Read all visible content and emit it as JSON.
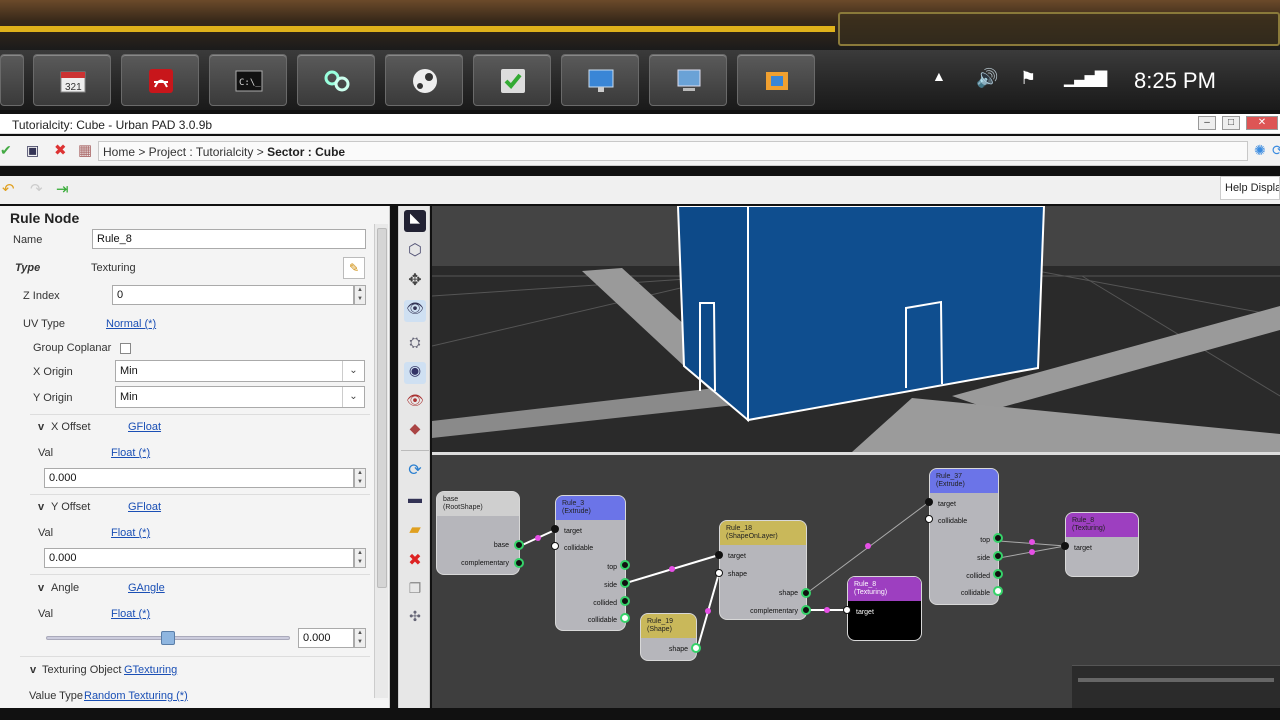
{
  "taskbar": {
    "apps": [
      "calendar-app-icon",
      "pdf-reader-icon",
      "command-prompt-icon",
      "network-app-icon",
      "steam-icon",
      "checklist-app-icon",
      "presentation-app-icon",
      "remote-desktop-icon",
      "paint-app-icon"
    ],
    "clock": "8:25 PM"
  },
  "window": {
    "title": "Tutorialcity: Cube - Urban PAD 3.0.9b"
  },
  "nav": {
    "breadcrumb_prefix": "Home > Project : Tutorialcity > ",
    "breadcrumb_current": "Sector : Cube"
  },
  "help_label": "Help Display",
  "panel": {
    "heading": "Rule Node",
    "name_label": "Name",
    "name_value": "Rule_8",
    "type_label": "Type",
    "type_value": "Texturing",
    "zindex_label": "Z Index",
    "zindex_value": "0",
    "uvtype_label": "UV Type",
    "uvtype_value": "Normal (*)",
    "group_coplanar_label": "Group Coplanar",
    "xorigin_label": "X Origin",
    "xorigin_value": "Min",
    "yorigin_label": "Y Origin",
    "yorigin_value": "Min",
    "xoffset_label": "X Offset",
    "xoffset_type": "GFloat",
    "xoffset_val_label": "Val",
    "xoffset_val_type": "Float (*)",
    "xoffset_val": "0.000",
    "yoffset_label": "Y Offset",
    "yoffset_type": "GFloat",
    "yoffset_val_label": "Val",
    "yoffset_val_type": "Float (*)",
    "yoffset_val": "0.000",
    "angle_label": "Angle",
    "angle_type": "GAngle",
    "angle_val_label": "Val",
    "angle_val_type": "Float (*)",
    "angle_val": "0.000",
    "angle_slider_fraction": 0.5,
    "texobj_label": "Texturing Object",
    "texobj_type": "GTexturing",
    "valuetype_label": "Value Type",
    "valuetype_value": "Random Texturing (*)"
  },
  "graph": {
    "nodes": {
      "base": {
        "title": "base",
        "sub": "(RootShape)",
        "ports_out": [
          "base",
          "complementary"
        ]
      },
      "rule3": {
        "title": "Rule_3",
        "sub": "(Extrude)",
        "ports_in": [
          "target",
          "collidable"
        ],
        "ports_out": [
          "top",
          "side",
          "collided",
          "collidable"
        ]
      },
      "rule19": {
        "title": "Rule_19",
        "sub": "(Shape)",
        "ports_out": [
          "shape"
        ]
      },
      "rule18": {
        "title": "Rule_18",
        "sub": "(ShapeOnLayer)",
        "ports_in": [
          "target",
          "shape"
        ],
        "ports_out": [
          "shape",
          "complementary"
        ]
      },
      "rule8a": {
        "title": "Rule_8",
        "sub": "(Texturing)",
        "ports_in": [
          "target"
        ]
      },
      "rule37": {
        "title": "Rule_37",
        "sub": "(Extrude)",
        "ports_in": [
          "target",
          "collidable"
        ],
        "ports_out": [
          "top",
          "side",
          "collided",
          "collidable"
        ]
      },
      "rule8b": {
        "title": "Rule_8",
        "sub": "(Texturing)",
        "ports_in": [
          "target"
        ]
      }
    }
  },
  "colors": {
    "extrude_header": "#6b74e8",
    "shape_header": "#c9b85a",
    "texturing_header": "#9d3fc0",
    "building": "#0f4e8f",
    "port_ring": "#36d36a"
  }
}
